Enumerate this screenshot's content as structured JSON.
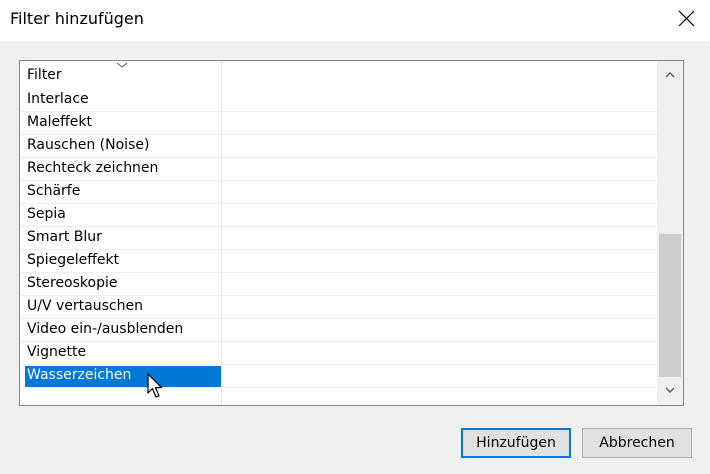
{
  "window": {
    "title": "Filter hinzufügen",
    "close_icon": "close-icon"
  },
  "list": {
    "column_header": "Filter",
    "items": [
      {
        "label": "Interlace",
        "selected": false
      },
      {
        "label": "Maleffekt",
        "selected": false
      },
      {
        "label": "Rauschen (Noise)",
        "selected": false
      },
      {
        "label": "Rechteck zeichnen",
        "selected": false
      },
      {
        "label": "Schärfe",
        "selected": false
      },
      {
        "label": "Sepia",
        "selected": false
      },
      {
        "label": "Smart Blur",
        "selected": false
      },
      {
        "label": "Spiegeleffekt",
        "selected": false
      },
      {
        "label": "Stereoskopie",
        "selected": false
      },
      {
        "label": "U/V vertauschen",
        "selected": false
      },
      {
        "label": "Video ein-/ausblenden",
        "selected": false
      },
      {
        "label": "Vignette",
        "selected": false
      },
      {
        "label": "Wasserzeichen",
        "selected": true
      }
    ]
  },
  "buttons": {
    "add_label": "Hinzufügen",
    "cancel_label": "Abbrechen"
  },
  "colors": {
    "selection": "#0078d7",
    "background": "#f0f0f0",
    "button_face": "#e1e1e1"
  }
}
